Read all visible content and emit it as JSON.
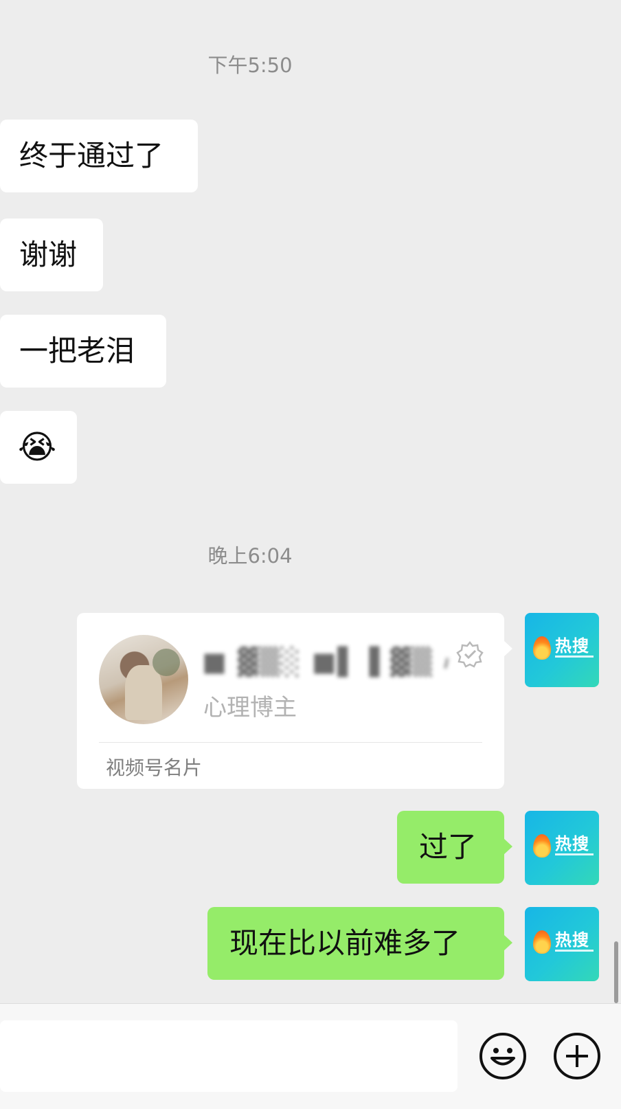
{
  "messages": {
    "time1": "下午5:50",
    "left": [
      "终于通过了",
      "谢谢",
      "一把老泪"
    ],
    "emoji": "😭",
    "time2": "晚上6:04",
    "card": {
      "name": "■ ▓▒░ ■▌▐ ▓▒ 心灵…",
      "role": "心理博主",
      "footer": "视频号名片",
      "verified_icon": "verified-check-icon"
    },
    "right": [
      "过了",
      "现在比以前难多了"
    ]
  },
  "avatar": {
    "brand": "热搜"
  },
  "colors": {
    "background": "#ededed",
    "outgoing_bubble": "#95ec69",
    "incoming_bubble": "#ffffff",
    "avatar_gradient_start": "#17b6e6",
    "avatar_gradient_end": "#33d8b8"
  },
  "input_bar": {
    "emoji_button_icon": "smiley-icon",
    "plus_button_icon": "plus-icon"
  }
}
